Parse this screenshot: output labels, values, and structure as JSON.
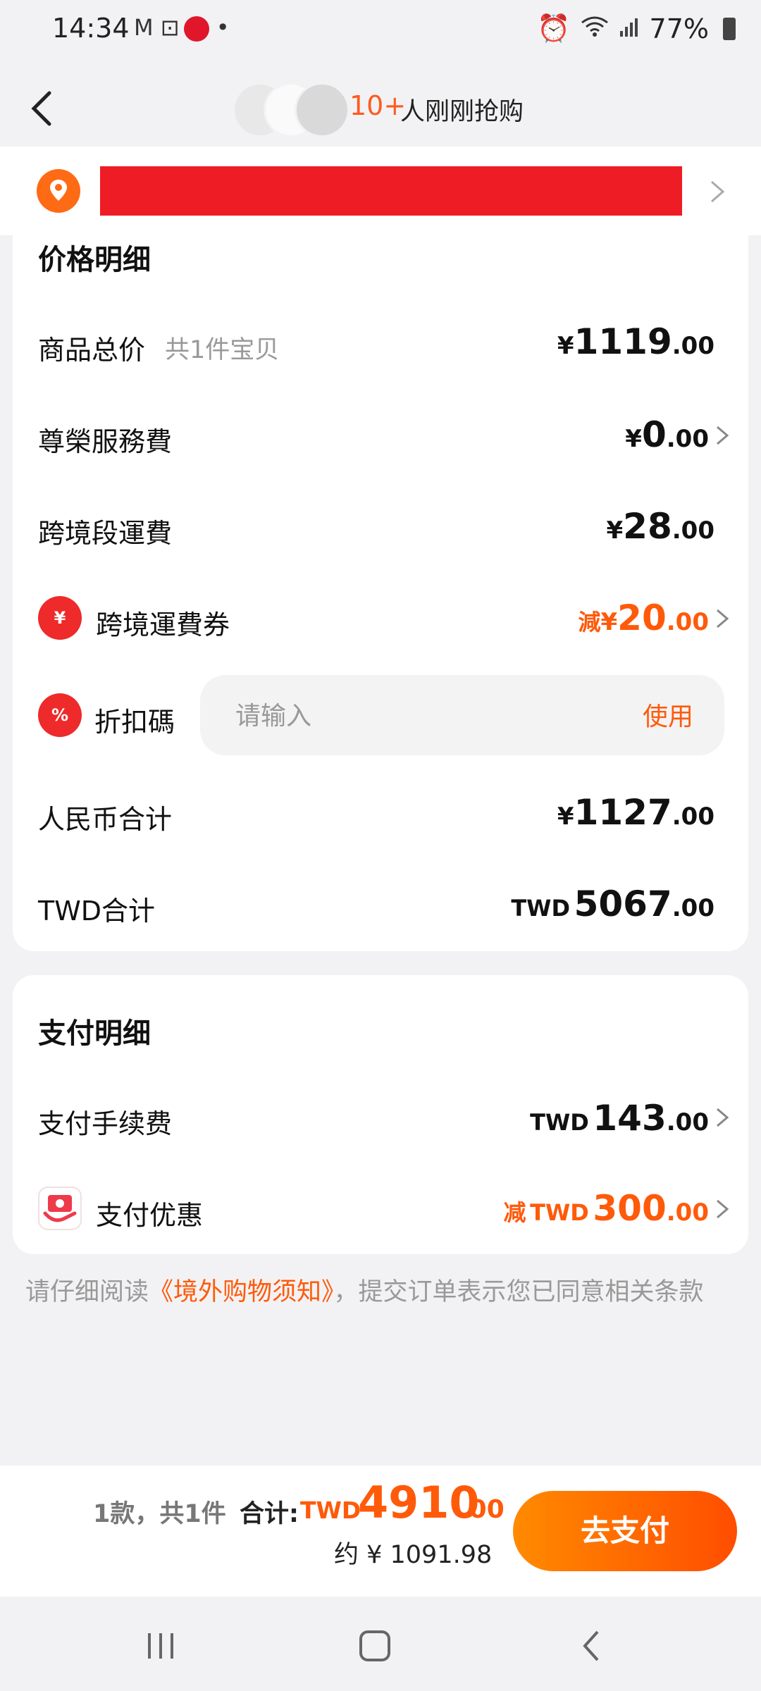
{
  "status_bar": {
    "time": "14:34",
    "notif_icons": "M ⊡",
    "battery": "77%"
  },
  "header": {
    "buy_count": "10+",
    "buy_text": "人刚刚抢购"
  },
  "price_detail": {
    "title": "价格明细",
    "rows": [
      {
        "label": "商品总价",
        "sub": "共1件宝贝",
        "symbol": "¥",
        "int": "1119",
        "dec": ".00"
      },
      {
        "label": "尊榮服務費",
        "symbol": "¥",
        "int": "0",
        "dec": ".00"
      },
      {
        "label": "跨境段運費",
        "symbol": "¥",
        "int": "28",
        "dec": ".00"
      },
      {
        "label": "跨境運費券",
        "pre": "減",
        "symbol": "¥",
        "int": "20",
        "dec": ".00",
        "icon_glyph": "¥"
      },
      {
        "label": "人民币合计",
        "symbol": "¥",
        "int": "1127",
        "dec": ".00"
      },
      {
        "label": "TWD合计",
        "symbol": "TWD",
        "int": "5067",
        "dec": ".00"
      }
    ],
    "discount": {
      "label": "折扣碼",
      "icon_glyph": "%",
      "placeholder": "请输入",
      "use_label": "使用"
    }
  },
  "payment_detail": {
    "title": "支付明细",
    "rows": [
      {
        "label": "支付手续费",
        "symbol": "TWD",
        "int": "143",
        "dec": ".00"
      },
      {
        "label": "支付优惠",
        "pre": "减",
        "symbol": "TWD",
        "int": "300",
        "dec": ".00"
      }
    ]
  },
  "notice": {
    "prefix": "请仔细阅读",
    "link": "《境外购物须知》",
    "suffix": "，提交订单表示您已同意相关条款"
  },
  "bottom_bar": {
    "count_text": "1款，共1件",
    "total_label": "合计:",
    "total_prefix": "TWD",
    "total_int": "4910",
    "total_dec": ".00",
    "approx": "约 ¥ 1091.98",
    "pay_label": "去支付"
  },
  "colors": {
    "accent": "#ff5a0a",
    "redaction": "#ee1c25",
    "background": "#f2f2f4"
  }
}
